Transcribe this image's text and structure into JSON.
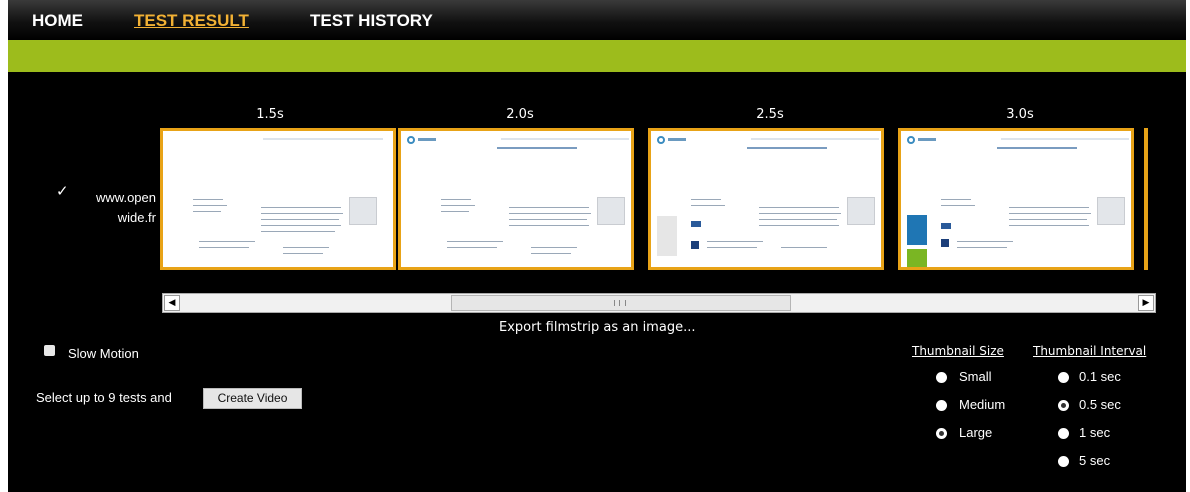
{
  "nav": {
    "items": [
      {
        "label": "HOME",
        "active": false
      },
      {
        "label": "TEST RESULT",
        "active": true
      },
      {
        "label": "TEST HISTORY",
        "active": false
      }
    ]
  },
  "colors": {
    "accent_green": "#9dbc1c",
    "active_nav": "#f2b134",
    "thumb_border": "#e8a317"
  },
  "filmstrip": {
    "times": [
      "1.5s",
      "2.0s",
      "2.5s",
      "3.0s"
    ],
    "test": {
      "checked": true,
      "url_line1": "www.open",
      "url_line2": "wide.fr"
    },
    "export_label": "Export filmstrip as an image..."
  },
  "options": {
    "slow_motion_label": "Slow Motion",
    "slow_motion_checked": false,
    "select_text": "Select up to 9 tests and",
    "create_video_label": "Create Video",
    "thumbnail_size": {
      "heading": "Thumbnail Size",
      "options": [
        {
          "label": "Small",
          "checked": false
        },
        {
          "label": "Medium",
          "checked": false
        },
        {
          "label": "Large",
          "checked": true
        }
      ]
    },
    "thumbnail_interval": {
      "heading": "Thumbnail Interval",
      "options": [
        {
          "label": "0.1 sec",
          "checked": false
        },
        {
          "label": "0.5 sec",
          "checked": true
        },
        {
          "label": "1 sec",
          "checked": false
        },
        {
          "label": "5 sec",
          "checked": false
        }
      ]
    }
  }
}
